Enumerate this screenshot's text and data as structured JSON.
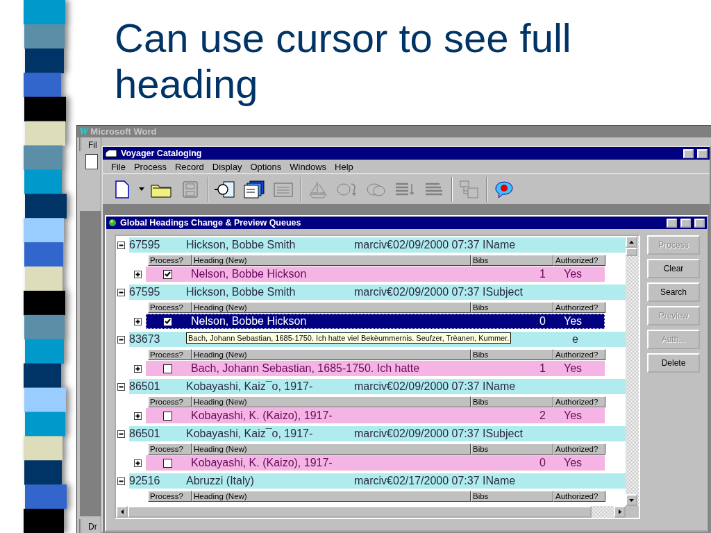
{
  "slide": {
    "title": "Can use cursor to see full heading"
  },
  "word_window": {
    "logo": "W",
    "title": "Microsoft Word",
    "menu_stub": "Fil",
    "status_stub": "Dr"
  },
  "app_window": {
    "title": "Voyager Cataloging",
    "menu": [
      "File",
      "Process",
      "Record",
      "Display",
      "Options",
      "Windows",
      "Help"
    ],
    "toolbar": [
      {
        "kind": "new",
        "disabled": false
      },
      {
        "kind": "dropdown",
        "disabled": false
      },
      {
        "kind": "open",
        "disabled": false
      },
      {
        "kind": "save",
        "disabled": true
      },
      {
        "kind": "separator"
      },
      {
        "kind": "find",
        "disabled": false
      },
      {
        "kind": "windows",
        "disabled": false
      },
      {
        "kind": "card",
        "disabled": true
      },
      {
        "kind": "separator"
      },
      {
        "kind": "ship",
        "disabled": true
      },
      {
        "kind": "heads-arrow",
        "disabled": true
      },
      {
        "kind": "heads",
        "disabled": true
      },
      {
        "kind": "list-arrow",
        "disabled": true
      },
      {
        "kind": "list",
        "disabled": true
      },
      {
        "kind": "separator"
      },
      {
        "kind": "tree",
        "disabled": true
      },
      {
        "kind": "separator"
      },
      {
        "kind": "help",
        "disabled": false
      }
    ]
  },
  "queue_window": {
    "title": "Global Headings Change &  Preview Queues",
    "groups": [
      {
        "id": "67595",
        "name": "Hickson, Bobbe Smith",
        "info": "marciv€02/09/2000 07:37 IName",
        "expanded": true,
        "columns": [
          "Process?",
          "Heading (New)",
          "Bibs",
          "Authorized?"
        ],
        "entry": {
          "expanded": false,
          "checked": true,
          "selected": false,
          "heading": "Nelson, Bobbe Hickson",
          "bibs": "1",
          "authorized": "Yes"
        }
      },
      {
        "id": "67595",
        "name": "Hickson, Bobbe Smith",
        "info": "marciv€02/09/2000 07:37 ISubject",
        "expanded": true,
        "columns": [
          "Process?",
          "Heading (New)",
          "Bibs",
          "Authorized?"
        ],
        "entry": {
          "expanded": false,
          "checked": true,
          "selected": true,
          "heading": "Nelson, Bobbe Hickson",
          "bibs": "0",
          "authorized": "Yes"
        }
      },
      {
        "id": "83673",
        "tail": "e",
        "tooltip": "Bach, Johann Sebastian, 1685-1750. Ich hatte viel Bekèummernis. Seufzer, Trèanen, Kummer.",
        "expanded": true,
        "columns": [
          "Process?",
          "Heading (New)",
          "Bibs",
          "Authorized?"
        ],
        "entry": {
          "expanded": false,
          "checked": false,
          "selected": false,
          "heading": "Bach, Johann Sebastian, 1685-1750. Ich hatte",
          "bibs": "1",
          "authorized": "Yes"
        }
      },
      {
        "id": "86501",
        "name": "Kobayashi, Kaiz¯o, 1917-",
        "info": "marciv€02/09/2000 07:37 IName",
        "expanded": true,
        "columns": [
          "Process?",
          "Heading (New)",
          "Bibs",
          "Authorized?"
        ],
        "entry": {
          "expanded": false,
          "checked": false,
          "selected": false,
          "heading": "Kobayashi, K. (Kaizo), 1917-",
          "bibs": "2",
          "authorized": "Yes"
        }
      },
      {
        "id": "86501",
        "name": "Kobayashi, Kaiz¯o, 1917-",
        "info": "marciv€02/09/2000 07:37 ISubject",
        "expanded": true,
        "columns": [
          "Process?",
          "Heading (New)",
          "Bibs",
          "Authorized?"
        ],
        "entry": {
          "expanded": false,
          "checked": false,
          "selected": false,
          "heading": "Kobayashi, K. (Kaizo), 1917-",
          "bibs": "0",
          "authorized": "Yes"
        }
      },
      {
        "id": "92516",
        "name": "Abruzzi (Italy)",
        "info": "marciv€02/17/2000 07:37 IName",
        "expanded": true,
        "columns": [
          "Process?",
          "Heading (New)",
          "Bibs",
          "Authorized?"
        ]
      }
    ],
    "buttons": [
      {
        "label": "Process",
        "disabled": true
      },
      {
        "label": "Clear",
        "disabled": false
      },
      {
        "label": "Search",
        "disabled": false
      },
      {
        "label": "Preview",
        "disabled": true
      },
      {
        "label": "Auth...",
        "disabled": true
      },
      {
        "label": "Delete",
        "disabled": false
      }
    ]
  }
}
